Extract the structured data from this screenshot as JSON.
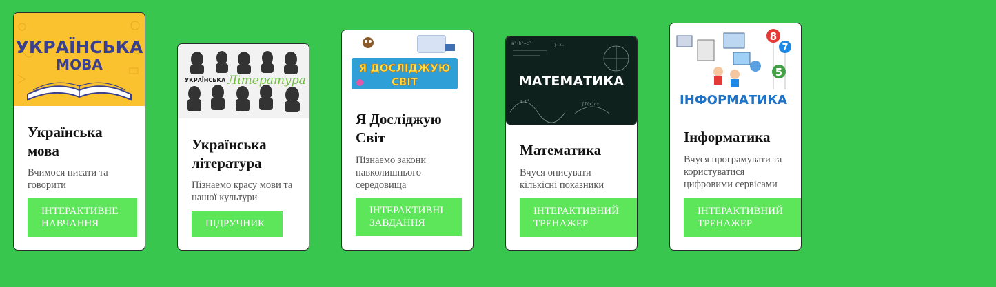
{
  "cards": [
    {
      "image_label_line1": "УКРАЇНСЬКА",
      "image_label_line2": "МОВА",
      "title": "Українська мова",
      "description": "Вчимося писати та говорити",
      "button": "ІНТЕРАКТИВНЕ НАВЧАННЯ"
    },
    {
      "image_label_small": "УКРАЇНСЬКА",
      "image_label_script": "Література",
      "title": "Українська література",
      "description": "Пізнаемо красу мови та нашої культури",
      "button": "ПІДРУЧНИК"
    },
    {
      "image_label_line1": "Я ДОСЛІДЖУЮ",
      "image_label_line2": "СВІТ",
      "title": "Я Досліджую Світ",
      "description": "Пізнаемо закони навколишнього середовища",
      "button": "ІНТЕРАКТИВНІ ЗАВДАННЯ"
    },
    {
      "image_label": "МАТЕМАТИКА",
      "title": "Математика",
      "description": "Вчуся описувати кількісні показники",
      "button": "ІНТЕРАКТИВНИЙ ТРЕНАЖЕР"
    },
    {
      "image_label": "ІНФОРМАТИКА",
      "balloons": [
        "8",
        "7",
        "5"
      ],
      "title": "Інформатика",
      "description": "Вчуся програмувати та користуватися цифровими сервісами",
      "button": "ІНТЕРАКТИВНИЙ ТРЕНАЖЕР"
    }
  ],
  "colors": {
    "page_background": "#38c64f",
    "button_background": "#5ee65a",
    "card_background": "#ffffff"
  }
}
